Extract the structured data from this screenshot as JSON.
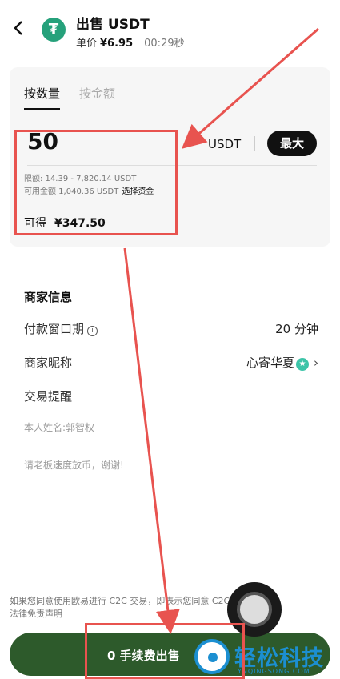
{
  "header": {
    "back_icon": "chevron-left-icon",
    "coin_symbol": "₮",
    "title": "出售 USDT",
    "price_label": "单价",
    "price_value": "¥6.95",
    "timer": "00:29秒"
  },
  "order": {
    "tabs": [
      {
        "label": "按数量",
        "active": true
      },
      {
        "label": "按金额",
        "active": false
      }
    ],
    "amount": "50",
    "unit": "USDT",
    "max_label": "最大",
    "limit_text": "限额: 14.39 - 7,820.14 USDT",
    "available_text": "可用金额 1,040.36 USDT",
    "select_funds_link": "选择资金",
    "receive_label": "可得",
    "receive_value": "¥347.50"
  },
  "merchant": {
    "title": "商家信息",
    "payment_window_label": "付款窗口期",
    "payment_window_value": "20 分钟",
    "nickname_label": "商家昵称",
    "nickname_value": "心寄华夏",
    "trade_reminder_label": "交易提醒",
    "note_name": "本人姓名:郭智权",
    "note_message": "请老板速度放币，谢谢!"
  },
  "footer": {
    "disclaimer_line1": "如果您同意使用欧易进行 C2C 交易，即表示您同意 C2C 交易",
    "disclaimer_line2": "法律免责声明",
    "sell_button": "0 手续费出售"
  },
  "watermark": {
    "text": "轻松科技",
    "sub": "YNQINGSONG.COM"
  },
  "colors": {
    "annotation_red": "#e8534f",
    "sell_button_green": "#2d5a2b",
    "tether_green": "#26a17b",
    "watermark_blue": "#1c8fd1"
  }
}
